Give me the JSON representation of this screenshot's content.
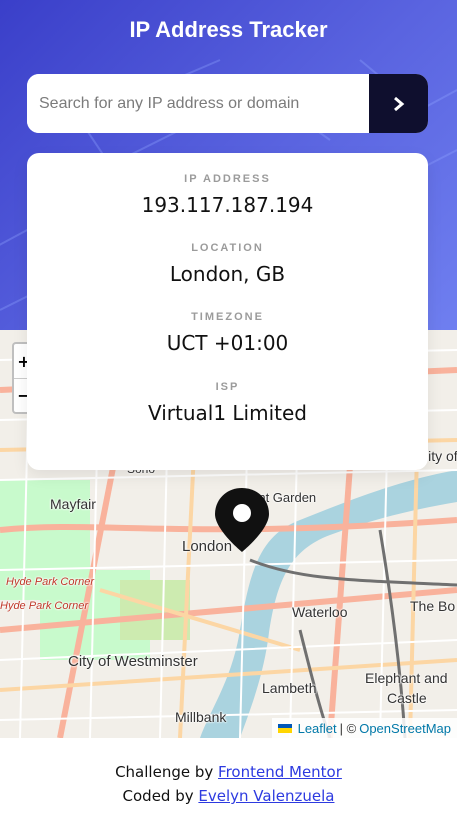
{
  "header": {
    "title": "IP Address Tracker"
  },
  "search": {
    "placeholder": "Search for any IP address or domain",
    "value": "",
    "submit_icon": "chevron-right-icon"
  },
  "info": {
    "items": [
      {
        "label": "IP ADDRESS",
        "value": "193.117.187.194"
      },
      {
        "label": "LOCATION",
        "value": "London, GB"
      },
      {
        "label": "TIMEZONE",
        "value": "UCT +01:00"
      },
      {
        "label": "ISP",
        "value": "Virtual1 Limited"
      }
    ]
  },
  "map": {
    "zoom_in": "+",
    "zoom_out": "−",
    "labels": {
      "soho": "Soho",
      "mayfair": "Mayfair",
      "covent_garden": "Covent Garden",
      "london": "London",
      "hyde_park_corner_1": "Hyde Park Corner",
      "hyde_park_corner_2": "Hyde Park Corner",
      "waterloo": "Waterloo",
      "the_bo": "The Bo",
      "city_of_westminster": "City of Westminster",
      "lambeth": "Lambeth",
      "elephant_and": "Elephant and",
      "castle": "Castle",
      "millbank": "Millbank",
      "city_of": "City of"
    },
    "attribution": {
      "leaflet": "Leaflet",
      "separator": "| ©",
      "osm": "OpenStreetMap"
    },
    "marker_icon": "location-pin-icon"
  },
  "footer": {
    "challenge_prefix": "Challenge by",
    "challenge_link": "Frontend Mentor",
    "coded_prefix": "Coded by",
    "coded_link": "Evelyn Valenzuela"
  },
  "colors": {
    "accent": "#0f0f2e",
    "link": "#2d3ae0",
    "river": "#aad3df",
    "hero": "#4a52d6"
  }
}
